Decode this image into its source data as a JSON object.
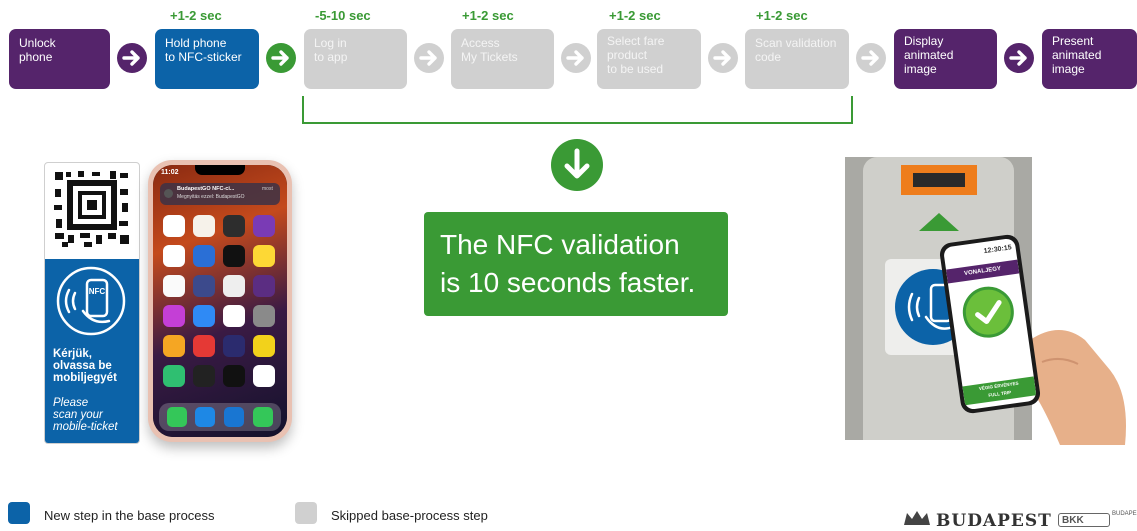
{
  "colors": {
    "purple": "#55246b",
    "blue": "#0c63a8",
    "gray": "#d0d0d0",
    "green": "#3a9a35"
  },
  "timings": [
    "+1-2 sec",
    "-5-10 sec",
    "+1-2 sec",
    "+1-2 sec",
    "+1-2 sec"
  ],
  "steps": [
    {
      "lines": [
        "Unlock",
        "phone"
      ],
      "kind": "base"
    },
    {
      "lines": [
        "Hold phone",
        "to NFC-sticker"
      ],
      "kind": "new"
    },
    {
      "lines": [
        "Log in",
        "to app"
      ],
      "kind": "skipped"
    },
    {
      "lines": [
        "Access",
        "My Tickets"
      ],
      "kind": "skipped"
    },
    {
      "lines": [
        "Select fare",
        "product",
        "to be used"
      ],
      "kind": "skipped"
    },
    {
      "lines": [
        "Scan validation",
        "code"
      ],
      "kind": "skipped"
    },
    {
      "lines": [
        "Display",
        "animated",
        "image"
      ],
      "kind": "base"
    },
    {
      "lines": [
        "Present",
        "animated",
        "image"
      ],
      "kind": "base"
    }
  ],
  "message": {
    "line1": "The NFC validation",
    "line2": "is 10 seconds faster."
  },
  "sticker": {
    "hu": [
      "Kérjük,",
      "olvassa be",
      "mobiljegyét"
    ],
    "en": [
      "Please",
      "scan your",
      "mobile-ticket"
    ],
    "nfc": "NFC"
  },
  "phone": {
    "time": "11:02",
    "notification_title": "BudapestGO NFC-ci...",
    "notification_body": "Megnyitás ezzel: BudapestGO",
    "notification_time": "most"
  },
  "validator_phone": {
    "time": "12:30:15",
    "header": "VONALJEGY",
    "status": "VÉGIG ÉRVÉNYES",
    "status2": "FULL TRIP"
  },
  "legend": [
    {
      "label": "New step in the base process",
      "kind": "new"
    },
    {
      "label": "Skipped base-process step",
      "kind": "skipped"
    }
  ],
  "logos": {
    "budapest": "BUDAPEST",
    "bkk": "BKK",
    "bkk_sub": "BUDAPE"
  }
}
